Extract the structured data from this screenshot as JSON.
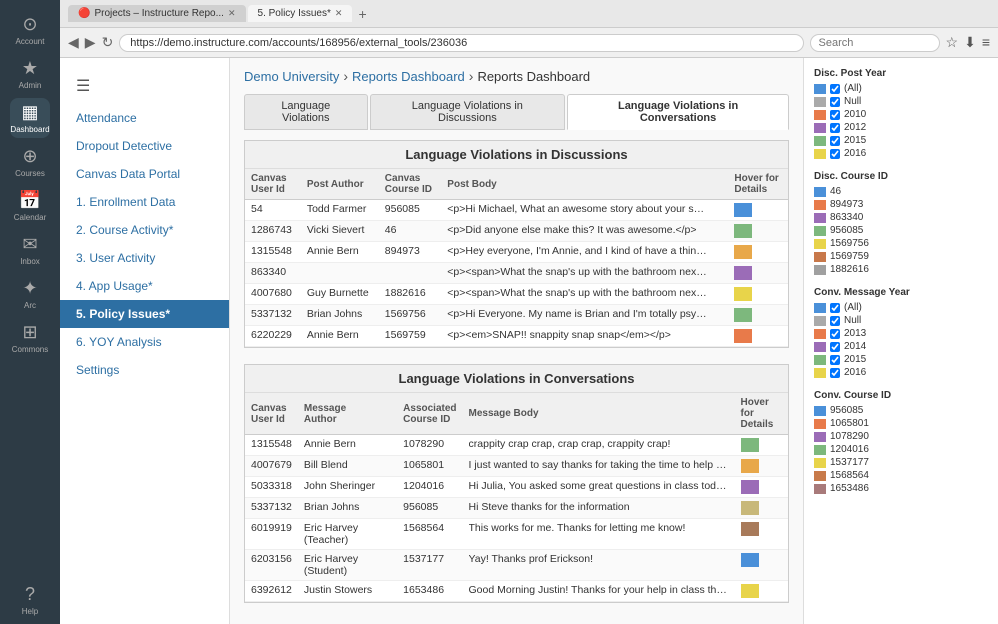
{
  "browser": {
    "tabs": [
      {
        "label": "Projects – Instructure Repo...",
        "icon": "🔴",
        "active": false
      },
      {
        "label": "5. Policy Issues*",
        "active": true
      }
    ],
    "url": "https://demo.instructure.com/accounts/168956/external_tools/236036",
    "search_placeholder": "Search"
  },
  "breadcrumb": {
    "parts": [
      "Demo University",
      "Reports Dashboard",
      "Reports Dashboard"
    ],
    "separators": [
      "›",
      "›"
    ]
  },
  "tabs": [
    {
      "label": "Language Violations",
      "active": false
    },
    {
      "label": "Language Violations in Discussions",
      "active": false
    },
    {
      "label": "Language Violations in Conversations",
      "active": true
    }
  ],
  "sidebar_items": [
    {
      "label": "Attendance",
      "active": false
    },
    {
      "label": "Dropout Detective",
      "active": false
    },
    {
      "label": "Canvas Data Portal",
      "active": false
    },
    {
      "label": "1. Enrollment Data",
      "active": false
    },
    {
      "label": "2. Course Activity*",
      "active": false
    },
    {
      "label": "3. User Activity",
      "active": false
    },
    {
      "label": "4. App Usage*",
      "active": false
    },
    {
      "label": "5. Policy Issues*",
      "active": true
    },
    {
      "label": "6. YOY Analysis",
      "active": false
    },
    {
      "label": "Settings",
      "active": false
    }
  ],
  "nav_icons": [
    {
      "icon": "⊙",
      "label": "Account"
    },
    {
      "icon": "★",
      "label": "Admin"
    },
    {
      "icon": "▦",
      "label": "Dashboard"
    },
    {
      "icon": "⊕",
      "label": "Courses"
    },
    {
      "icon": "📅",
      "label": "Calendar"
    },
    {
      "icon": "✉",
      "label": "Inbox"
    },
    {
      "icon": "✦",
      "label": "Arc"
    },
    {
      "icon": "⊞",
      "label": "Commons"
    },
    {
      "icon": "?",
      "label": "Help"
    }
  ],
  "discussions_table": {
    "title": "Language Violations in Discussions",
    "headers": [
      "Canvas User Id",
      "Post Author",
      "Canvas Course ID",
      "Post Body",
      "Hover for Details"
    ],
    "rows": [
      {
        "user_id": "54",
        "author": "Todd Farmer",
        "course_id": "956085",
        "body": "<p>Hi Michael, What an awesome story about your summer. I spent it with my uncle in Alaska hunting wolverines. They kept trying to attack my cousins, what the heck would you do in a situat...",
        "color": "#4a90d9"
      },
      {
        "user_id": "1286743",
        "author": "Vicki Sievert",
        "course_id": "46",
        "body": "<p>Did anyone else make this? It was awesome.</p>",
        "color": "#7db87d"
      },
      {
        "user_id": "1315548",
        "author": "Annie Bern",
        "course_id": "894973",
        "body": "<p>Hey everyone, I'm Annie, and I kind of have a thing for oceanography!</p><p>I got to spend 10 weeks at the Monterey Bay Aquarium's summer intern program this last summer—it was pretty...",
        "color": "#e8a84a"
      },
      {
        "user_id": "863340",
        "author": "",
        "course_id": "",
        "body": "<p><span>What the snap's up with the bathroom next to the classroom? It's always </span><span>locked for maintenance</span><span>. Where the heck is the closest alternative...",
        "color": "#9b6cb7"
      },
      {
        "user_id": "4007680",
        "author": "Guy Burnette",
        "course_id": "1882616",
        "body": "<p><span>What the snap's up with the bathroom next to the classroom? It's always </span><span>locked for maintenance</span><span>. Where the heck is the closest alternative...",
        "color": "#e8d44a"
      },
      {
        "user_id": "5337132",
        "author": "Brian Johns",
        "course_id": "1569756",
        "body": "<p>Hi Everyone. My name is Brian and I'm totally psyched to be in this class. I just know it's going to be awesome. My favorite artist is Metallica, old school. Rock on!</p><p><cite class=\"_Rm\"...",
        "color": "#7db87d"
      },
      {
        "user_id": "6220229",
        "author": "Annie Bern",
        "course_id": "1569759",
        "body": "<p><em>SNAP!! snappity snap snap</em></p>",
        "color": "#e87a4a"
      }
    ]
  },
  "conversations_table": {
    "title": "Language Violations in Conversations",
    "headers": [
      "Canvas User Id",
      "Message Author",
      "Associated Course ID",
      "Message Body",
      "Hover for Details"
    ],
    "rows": [
      {
        "user_id": "1315548",
        "author": "Annie Bern",
        "course_id": "1078290",
        "body": "crappity crap crap, crap crap, crappity crap!",
        "color": "#7db87d"
      },
      {
        "user_id": "4007679",
        "author": "Bill Blend",
        "course_id": "1065801",
        "body": "I just wanted to say thanks for taking the time to help me through some of the content I was struggling with. I feel like it know it much better.",
        "color": "#e8a84a"
      },
      {
        "user_id": "5033318",
        "author": "John Sheringer",
        "course_id": "1204016",
        "body": "Hi Julia,\n\nYou asked some great questions in class today. Thanks for being an active participant!\n\n- Dr. S.",
        "color": "#9b6cb7"
      },
      {
        "user_id": "5337132",
        "author": "Brian Johns",
        "course_id": "956085",
        "body": "Hi Steve thanks for the information",
        "color": "#c8b87a"
      },
      {
        "user_id": "6019919",
        "author": "Eric Harvey (Teacher)",
        "course_id": "1568564",
        "body": "This works for me. Thanks for letting me know!",
        "color": "#a87a5a"
      },
      {
        "user_id": "6203156",
        "author": "Eric Harvey (Student)",
        "course_id": "1537177",
        "body": "Yay! Thanks prof Erickson!",
        "color": "#4a90d9"
      },
      {
        "user_id": "6392612",
        "author": "Justin Stowers",
        "course_id": "1653486",
        "body": "Good Morning Justin! Thanks for your help in class the other day. I appreciated your comments and the leadership you displayed in assisting me with my presentation. \n\nThanks!",
        "color": "#e8d44a"
      }
    ]
  },
  "right_sidebar": {
    "disc_post_year": {
      "title": "Disc. Post Year",
      "items": [
        {
          "label": "(All)",
          "checked": true,
          "color": "#4a90d9"
        },
        {
          "label": "Null",
          "checked": true,
          "color": "#aaa"
        },
        {
          "label": "2010",
          "checked": true,
          "color": "#e87a4a"
        },
        {
          "label": "2012",
          "checked": true,
          "color": "#9b6cb7"
        },
        {
          "label": "2015",
          "checked": true,
          "color": "#7db87d"
        },
        {
          "label": "2016",
          "checked": true,
          "color": "#e8d44a"
        }
      ]
    },
    "disc_course_id": {
      "title": "Disc. Course ID",
      "items": [
        {
          "label": "46",
          "color": "#4a90d9"
        },
        {
          "label": "894973",
          "color": "#e87a4a"
        },
        {
          "label": "863340",
          "color": "#9b6cb7"
        },
        {
          "label": "956085",
          "color": "#7db87d"
        },
        {
          "label": "1569756",
          "color": "#e8d44a"
        },
        {
          "label": "1569759",
          "color": "#c8784a"
        },
        {
          "label": "1882616",
          "color": "#a0a0a0"
        }
      ]
    },
    "conv_message_year": {
      "title": "Conv. Message Year",
      "items": [
        {
          "label": "(All)",
          "checked": true,
          "color": "#4a90d9"
        },
        {
          "label": "Null",
          "checked": true,
          "color": "#aaa"
        },
        {
          "label": "2013",
          "checked": true,
          "color": "#e87a4a"
        },
        {
          "label": "2014",
          "checked": true,
          "color": "#9b6cb7"
        },
        {
          "label": "2015",
          "checked": true,
          "color": "#7db87d"
        },
        {
          "label": "2016",
          "checked": true,
          "color": "#e8d44a"
        }
      ]
    },
    "conv_course_id": {
      "title": "Conv. Course ID",
      "items": [
        {
          "label": "956085",
          "color": "#4a90d9"
        },
        {
          "label": "1065801",
          "color": "#e87a4a"
        },
        {
          "label": "1078290",
          "color": "#9b6cb7"
        },
        {
          "label": "1204016",
          "color": "#7db87d"
        },
        {
          "label": "1537177",
          "color": "#e8d44a"
        },
        {
          "label": "1568564",
          "color": "#c87a4a"
        },
        {
          "label": "1653486",
          "color": "#a87a7a"
        }
      ]
    }
  }
}
